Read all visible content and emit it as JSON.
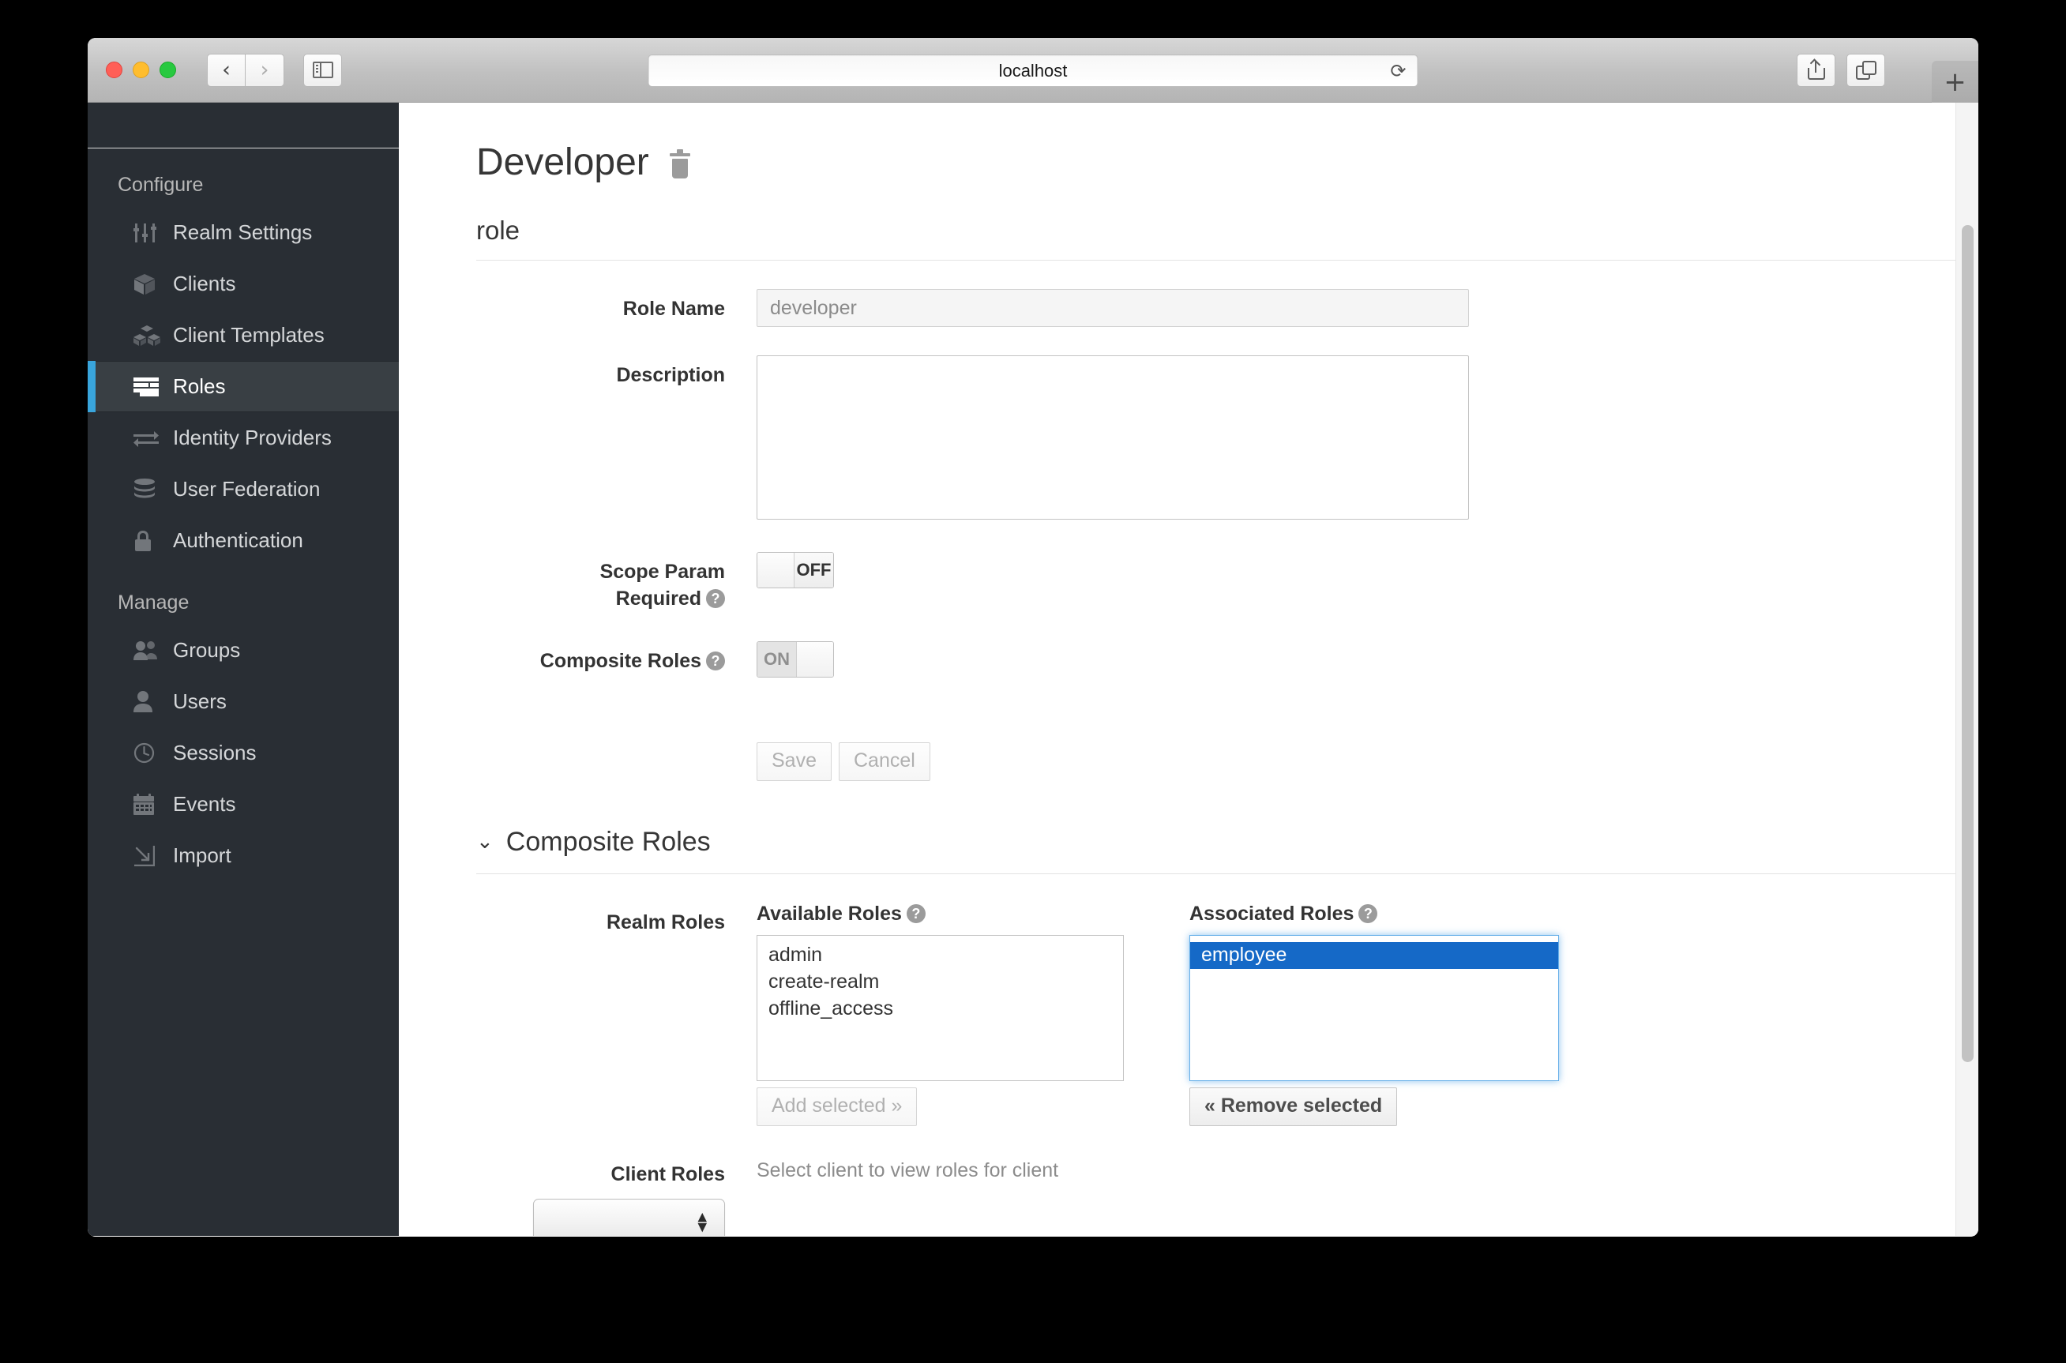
{
  "browser": {
    "url_text": "localhost",
    "reload_icon": "reload-icon",
    "back_icon": "back-chevron-icon",
    "forward_icon": "forward-chevron-icon",
    "sidebar_toggle_icon": "sidebar-toggle-icon",
    "share_icon": "share-icon",
    "tabs_overview_icon": "tabs-overview-icon",
    "new_tab_label": "+"
  },
  "sidebar": {
    "sections": [
      {
        "title": "Configure",
        "items": [
          {
            "label": "Realm Settings",
            "icon": "sliders-icon",
            "active": false
          },
          {
            "label": "Clients",
            "icon": "cube-icon",
            "active": false
          },
          {
            "label": "Client Templates",
            "icon": "cubes-icon",
            "active": false
          },
          {
            "label": "Roles",
            "icon": "roles-bars-icon",
            "active": true
          },
          {
            "label": "Identity Providers",
            "icon": "exchange-arrows-icon",
            "active": false
          },
          {
            "label": "User Federation",
            "icon": "database-icon",
            "active": false
          },
          {
            "label": "Authentication",
            "icon": "lock-icon",
            "active": false
          }
        ]
      },
      {
        "title": "Manage",
        "items": [
          {
            "label": "Groups",
            "icon": "group-users-icon",
            "active": false
          },
          {
            "label": "Users",
            "icon": "user-icon",
            "active": false
          },
          {
            "label": "Sessions",
            "icon": "clock-icon",
            "active": false
          },
          {
            "label": "Events",
            "icon": "calendar-icon",
            "active": false
          },
          {
            "label": "Import",
            "icon": "import-arrow-icon",
            "active": false
          }
        ]
      }
    ]
  },
  "main": {
    "page_title": "Developer",
    "delete_icon": "trash-icon",
    "subtitle": "role",
    "form": {
      "role_name_label": "Role Name",
      "role_name_value": "developer",
      "description_label": "Description",
      "description_value": "",
      "scope_param_label_line1": "Scope Param",
      "scope_param_label_line2": "Required",
      "scope_param_state": "OFF",
      "composite_roles_label": "Composite Roles",
      "composite_roles_state": "ON",
      "save_label": "Save",
      "cancel_label": "Cancel",
      "help_icon": "help-circle-icon"
    },
    "composite": {
      "section_title": "Composite Roles",
      "chevron_icon": "chevron-down-icon",
      "realm_roles_label": "Realm Roles",
      "available_roles_label": "Available Roles",
      "available_roles": [
        "admin",
        "create-realm",
        "offline_access"
      ],
      "add_selected_label": "Add selected »",
      "associated_roles_label": "Associated Roles",
      "associated_roles": [
        "employee"
      ],
      "associated_selected": "employee",
      "remove_selected_label": "« Remove selected",
      "client_roles_label": "Client Roles",
      "client_roles_select_value": "",
      "client_roles_hint": "Select client to view roles for client"
    }
  },
  "colors": {
    "sidebar_bg": "#292e34",
    "sidebar_active_bg": "#393f44",
    "accent_blue": "#39a5dc",
    "selection_blue": "#1569c7",
    "focus_blue": "#66afe9"
  }
}
